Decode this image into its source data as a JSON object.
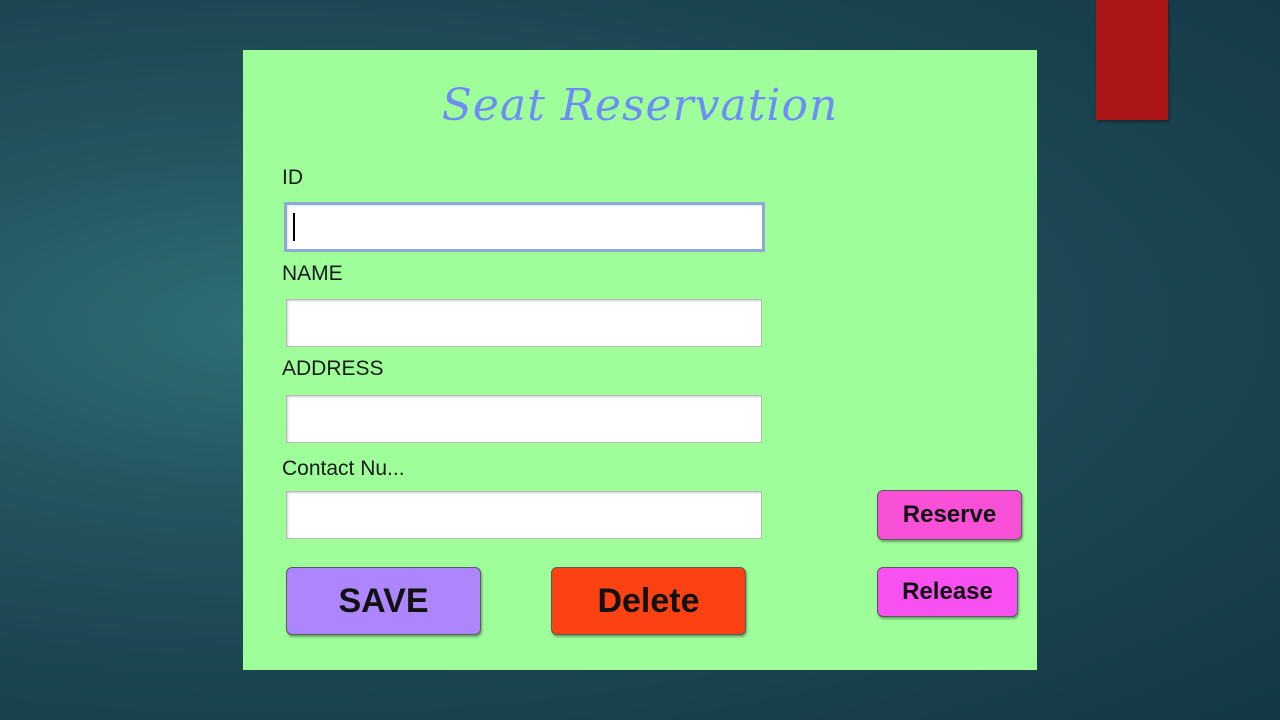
{
  "form": {
    "title": "Seat Reservation",
    "fields": [
      {
        "label": "ID",
        "value": "",
        "focused": true
      },
      {
        "label": "NAME",
        "value": ""
      },
      {
        "label": "ADDRESS",
        "value": ""
      },
      {
        "label": "Contact Nu...",
        "value": ""
      }
    ]
  },
  "buttons": {
    "save_label": "SAVE",
    "delete_label": "Delete",
    "reserve_label": "Reserve",
    "release_label": "Release"
  },
  "colors": {
    "panel_background": "#9dfe9a",
    "title_text": "#6f8df7",
    "save_button": "#ad85fc",
    "delete_button": "#fc4213",
    "reserve_button": "#f950d8",
    "release_button": "#f950f2",
    "slide_accent": "#ad1616",
    "focus_border": "#8ea9d6"
  }
}
